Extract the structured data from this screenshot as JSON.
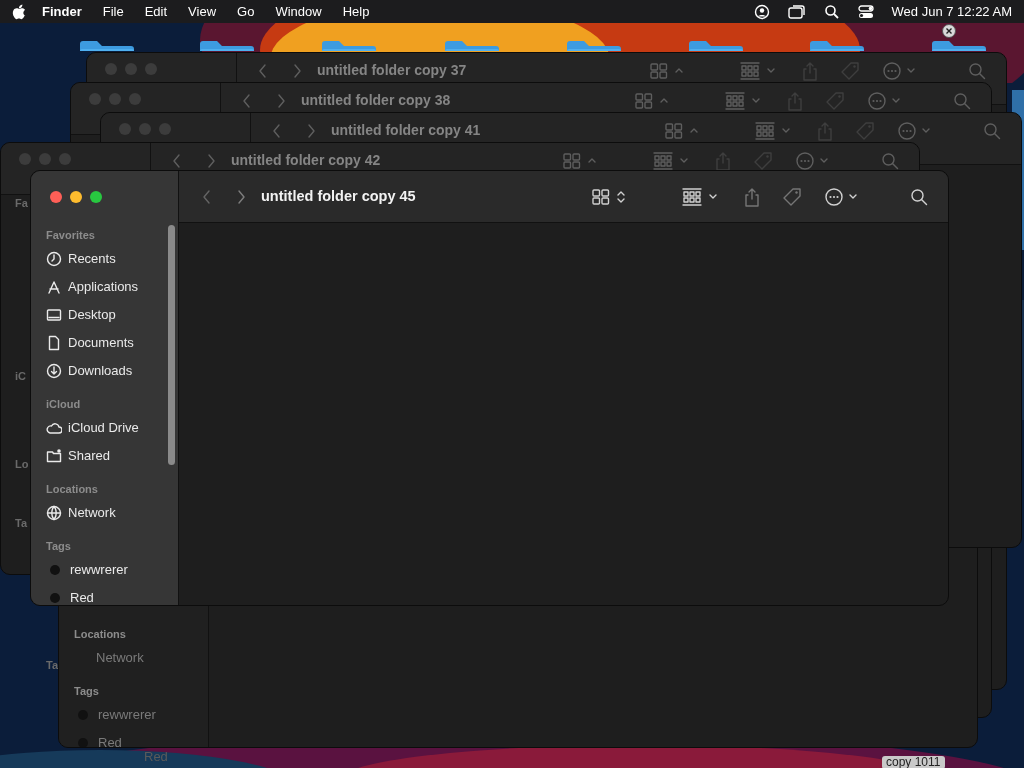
{
  "menu_bar": {
    "app": "Finder",
    "menus": [
      "File",
      "Edit",
      "View",
      "Go",
      "Window",
      "Help"
    ],
    "clock": "Wed Jun 7  12:22 AM"
  },
  "desktop": {
    "icon_labels": [
      "copy 1011"
    ]
  },
  "background_windows": [
    {
      "title": "untitled folder copy 37"
    },
    {
      "title": "untitled folder copy 38"
    },
    {
      "title": "untitled folder copy 41"
    },
    {
      "title": "untitled folder copy 42"
    }
  ],
  "edge_fragments": [
    "Fa",
    "iC",
    "Lo",
    "Ta",
    "Ta"
  ],
  "lower_window": {
    "sections": [
      {
        "heading": "Locations",
        "kind": "places",
        "items": [
          {
            "label": "Network"
          }
        ]
      },
      {
        "heading": "Tags",
        "kind": "tags",
        "items": [
          {
            "label": "rewwrerer",
            "color": "#111111"
          },
          {
            "label": "Red",
            "color": "#111111"
          }
        ]
      }
    ]
  },
  "stray_label": "Red",
  "front_window": {
    "title": "untitled folder copy 45",
    "sidebar": [
      {
        "heading": "Favorites",
        "kind": "places",
        "items": [
          {
            "label": "Recents"
          },
          {
            "label": "Applications"
          },
          {
            "label": "Desktop"
          },
          {
            "label": "Documents"
          },
          {
            "label": "Downloads"
          }
        ]
      },
      {
        "heading": "iCloud",
        "kind": "places",
        "items": [
          {
            "label": "iCloud Drive"
          },
          {
            "label": "Shared"
          }
        ]
      },
      {
        "heading": "Locations",
        "kind": "places",
        "items": [
          {
            "label": "Network"
          }
        ]
      },
      {
        "heading": "Tags",
        "kind": "tags",
        "items": [
          {
            "label": "rewwrerer",
            "color": "#111111"
          },
          {
            "label": "Red",
            "color": "#111111"
          }
        ]
      }
    ]
  }
}
